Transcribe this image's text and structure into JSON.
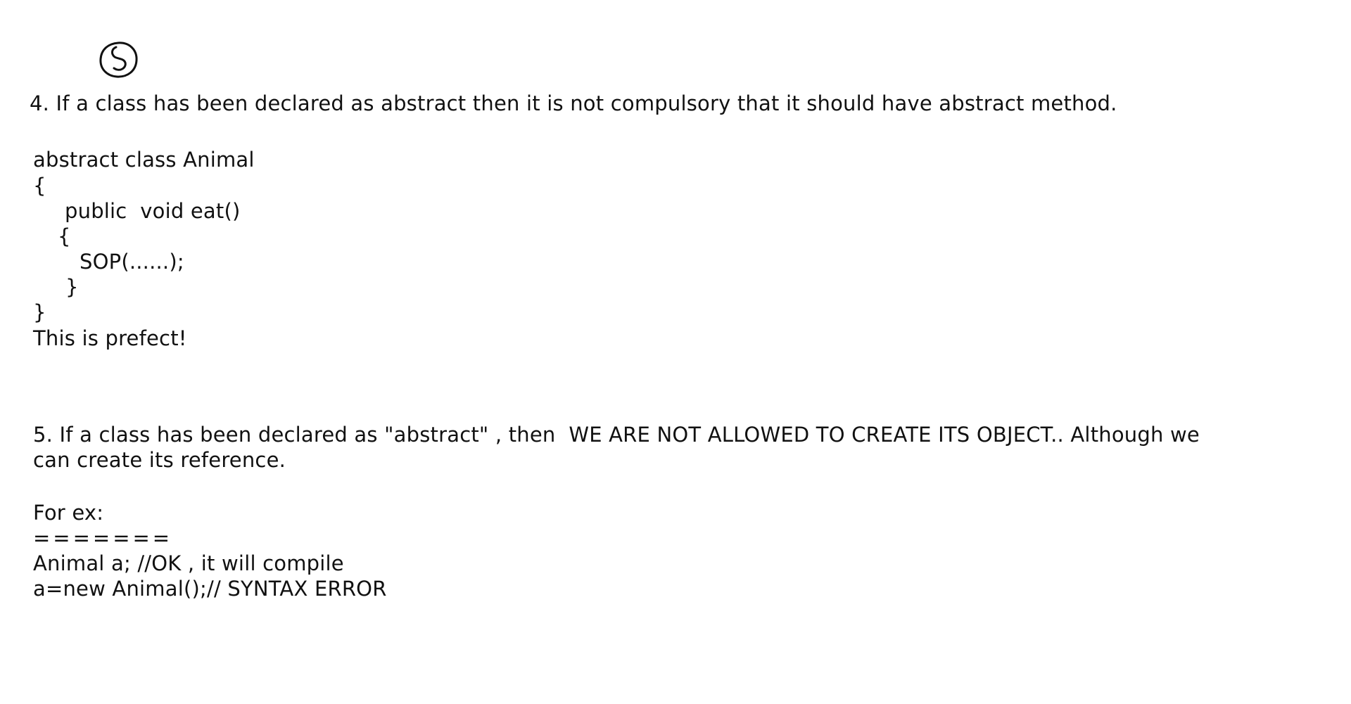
{
  "annotation": {
    "circle_mark": "5"
  },
  "point4": {
    "heading": "4. If a class has been declared as abstract then it is not compulsory that it should have abstract method.",
    "code": [
      "abstract class Animal",
      "{",
      "public  void eat()",
      "{",
      "SOP(......);",
      "}",
      "}"
    ],
    "conclusion": "This is prefect!"
  },
  "point5": {
    "heading_line1": "5. If a class has been declared as \"abstract\" , then  WE ARE NOT ALLOWED TO CREATE ITS OBJECT.. Although we",
    "heading_line2": "can create its reference.",
    "example_label": "For ex:",
    "underline": "=======",
    "example_lines": [
      "Animal a; //OK , it will compile",
      "a=new Animal();// SYNTAX ERROR"
    ]
  }
}
